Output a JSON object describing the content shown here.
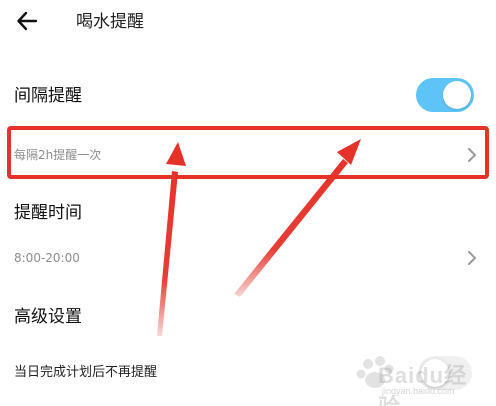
{
  "header": {
    "title": "喝水提醒",
    "back_icon": "arrow-left-icon"
  },
  "interval_reminder": {
    "label": "间隔提醒",
    "enabled": true,
    "toggle_color": "#5ec4f7",
    "value": "每隔2h提醒一次"
  },
  "reminder_time": {
    "label": "提醒时间",
    "value": "8:00-20:00"
  },
  "advanced": {
    "label": "高级设置",
    "stop_after_plan_label": "当日完成计划后不再提醒"
  },
  "annotation": {
    "highlight_color": "#e5332a"
  },
  "watermark": {
    "text": "Baidu经验",
    "sub": "jingyan.baidu.com"
  }
}
